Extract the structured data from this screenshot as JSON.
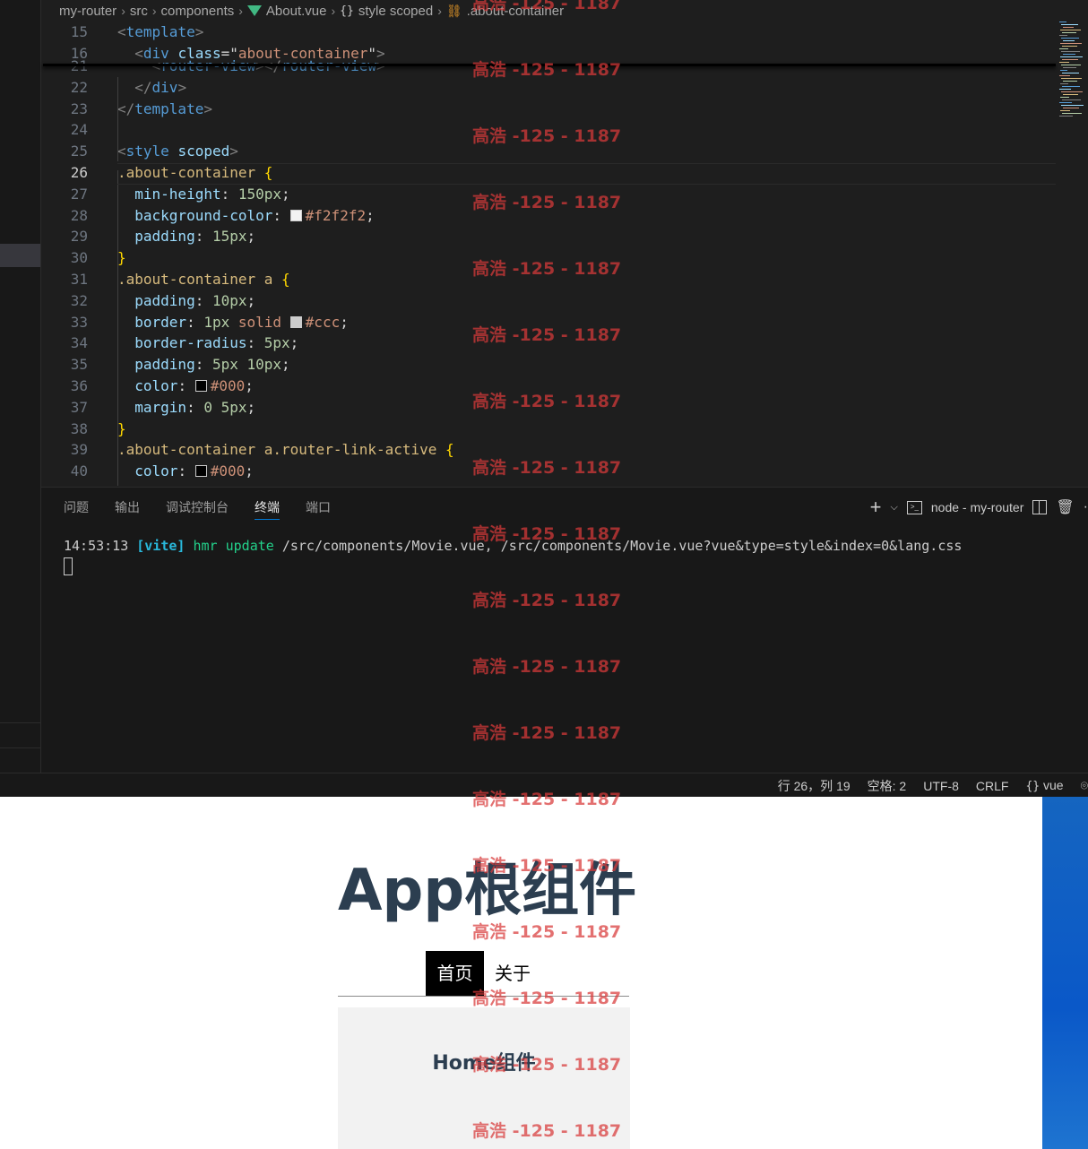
{
  "breadcrumb": {
    "root": "my-router",
    "folder1": "src",
    "folder2": "components",
    "file": "About.vue",
    "section": "style scoped",
    "symbol": ".about-container"
  },
  "editor": {
    "sticky": [
      {
        "n": "15",
        "tokens": [
          {
            "t": "<",
            "c": "punc"
          },
          {
            "t": "template",
            "c": "tag"
          },
          {
            "t": ">",
            "c": "punc"
          }
        ]
      },
      {
        "n": "16",
        "tokens": [
          {
            "t": "  <",
            "c": "punc"
          },
          {
            "t": "div",
            "c": "tag"
          },
          {
            "t": " ",
            "c": ""
          },
          {
            "t": "class",
            "c": "attr"
          },
          {
            "t": "=\"",
            "c": ""
          },
          {
            "t": "about-container",
            "c": "str"
          },
          {
            "t": "\"",
            "c": ""
          },
          {
            "t": ">",
            "c": "punc"
          }
        ]
      }
    ],
    "lines": [
      {
        "n": "21",
        "tokens": [
          {
            "t": "    <",
            "c": "punc"
          },
          {
            "t": "router-view",
            "c": "tag"
          },
          {
            "t": "></",
            "c": "punc"
          },
          {
            "t": "router-view",
            "c": "tag"
          },
          {
            "t": ">",
            "c": "punc"
          }
        ]
      },
      {
        "n": "22",
        "tokens": [
          {
            "t": "  </",
            "c": "punc"
          },
          {
            "t": "div",
            "c": "tag"
          },
          {
            "t": ">",
            "c": "punc"
          }
        ]
      },
      {
        "n": "23",
        "tokens": [
          {
            "t": "</",
            "c": "punc"
          },
          {
            "t": "template",
            "c": "tag"
          },
          {
            "t": ">",
            "c": "punc"
          }
        ]
      },
      {
        "n": "24",
        "tokens": []
      },
      {
        "n": "25",
        "tokens": [
          {
            "t": "<",
            "c": "punc"
          },
          {
            "t": "style",
            "c": "tag"
          },
          {
            "t": " ",
            "c": ""
          },
          {
            "t": "scoped",
            "c": "attr"
          },
          {
            "t": ">",
            "c": "punc"
          }
        ]
      },
      {
        "n": "26",
        "active": true,
        "tokens": [
          {
            "t": ".about-container ",
            "c": "sel"
          },
          {
            "t": "{",
            "c": "brace"
          }
        ]
      },
      {
        "n": "27",
        "tokens": [
          {
            "t": "  min-height",
            "c": "prop"
          },
          {
            "t": ": ",
            "c": ""
          },
          {
            "t": "150px",
            "c": "num"
          },
          {
            "t": ";",
            "c": ""
          }
        ]
      },
      {
        "n": "28",
        "tokens": [
          {
            "t": "  background-color",
            "c": "prop"
          },
          {
            "t": ": ",
            "c": ""
          },
          {
            "t": "#f2f2f2",
            "c": "val",
            "swatch": "#f2f2f2"
          },
          {
            "t": ";",
            "c": ""
          }
        ]
      },
      {
        "n": "29",
        "tokens": [
          {
            "t": "  padding",
            "c": "prop"
          },
          {
            "t": ": ",
            "c": ""
          },
          {
            "t": "15px",
            "c": "num"
          },
          {
            "t": ";",
            "c": ""
          }
        ]
      },
      {
        "n": "30",
        "tokens": [
          {
            "t": "}",
            "c": "brace"
          }
        ]
      },
      {
        "n": "31",
        "tokens": [
          {
            "t": ".about-container a ",
            "c": "sel"
          },
          {
            "t": "{",
            "c": "brace"
          }
        ]
      },
      {
        "n": "32",
        "tokens": [
          {
            "t": "  padding",
            "c": "prop"
          },
          {
            "t": ": ",
            "c": ""
          },
          {
            "t": "10px",
            "c": "num"
          },
          {
            "t": ";",
            "c": ""
          }
        ]
      },
      {
        "n": "33",
        "tokens": [
          {
            "t": "  border",
            "c": "prop"
          },
          {
            "t": ": ",
            "c": ""
          },
          {
            "t": "1px",
            "c": "num"
          },
          {
            "t": " solid ",
            "c": "val"
          },
          {
            "t": "#ccc",
            "c": "val",
            "swatch": "#cccccc"
          },
          {
            "t": ";",
            "c": ""
          }
        ]
      },
      {
        "n": "34",
        "tokens": [
          {
            "t": "  border-radius",
            "c": "prop"
          },
          {
            "t": ": ",
            "c": ""
          },
          {
            "t": "5px",
            "c": "num"
          },
          {
            "t": ";",
            "c": ""
          }
        ]
      },
      {
        "n": "35",
        "tokens": [
          {
            "t": "  padding",
            "c": "prop"
          },
          {
            "t": ": ",
            "c": ""
          },
          {
            "t": "5px 10px",
            "c": "num"
          },
          {
            "t": ";",
            "c": ""
          }
        ]
      },
      {
        "n": "36",
        "tokens": [
          {
            "t": "  color",
            "c": "prop"
          },
          {
            "t": ": ",
            "c": ""
          },
          {
            "t": "#000",
            "c": "val",
            "swatch": "#000000"
          },
          {
            "t": ";",
            "c": ""
          }
        ]
      },
      {
        "n": "37",
        "tokens": [
          {
            "t": "  margin",
            "c": "prop"
          },
          {
            "t": ": ",
            "c": ""
          },
          {
            "t": "0 5px",
            "c": "num"
          },
          {
            "t": ";",
            "c": ""
          }
        ]
      },
      {
        "n": "38",
        "tokens": [
          {
            "t": "}",
            "c": "brace"
          }
        ]
      },
      {
        "n": "39",
        "tokens": [
          {
            "t": ".about-container a.router-link-active ",
            "c": "sel"
          },
          {
            "t": "{",
            "c": "brace"
          }
        ]
      },
      {
        "n": "40",
        "tokens": [
          {
            "t": "  color",
            "c": "prop"
          },
          {
            "t": ": ",
            "c": ""
          },
          {
            "t": "#000",
            "c": "val",
            "swatch": "#000000"
          },
          {
            "t": ";",
            "c": ""
          }
        ]
      }
    ]
  },
  "panel": {
    "tabs": [
      "问题",
      "输出",
      "调试控制台",
      "终端",
      "端口"
    ],
    "active_tab": "终端",
    "terminal_name": "node - my-router",
    "output": {
      "time": "14:53:13",
      "tag": "[vite]",
      "cmd": "hmr update",
      "paths": "/src/components/Movie.vue, /src/components/Movie.vue?vue&type=style&index=0&lang.css"
    }
  },
  "statusbar": {
    "position": "行 26，列 19",
    "indent": "空格: 2",
    "encoding": "UTF-8",
    "eol": "CRLF",
    "language": "vue"
  },
  "browser": {
    "title": "App根组件",
    "nav": {
      "home": "首页",
      "about": "关于"
    },
    "content_heading": "Home组件"
  },
  "watermark": "高浩 -125 - 1187",
  "colors": {
    "editor_bg": "#1e1e1e",
    "panel_bg": "#181818",
    "title_text": "#2c3e50",
    "active_link_bg": "#000000",
    "content_bg": "#f2f2f2",
    "watermark": "#d93a3a",
    "tab_underline": "#0078d4"
  }
}
